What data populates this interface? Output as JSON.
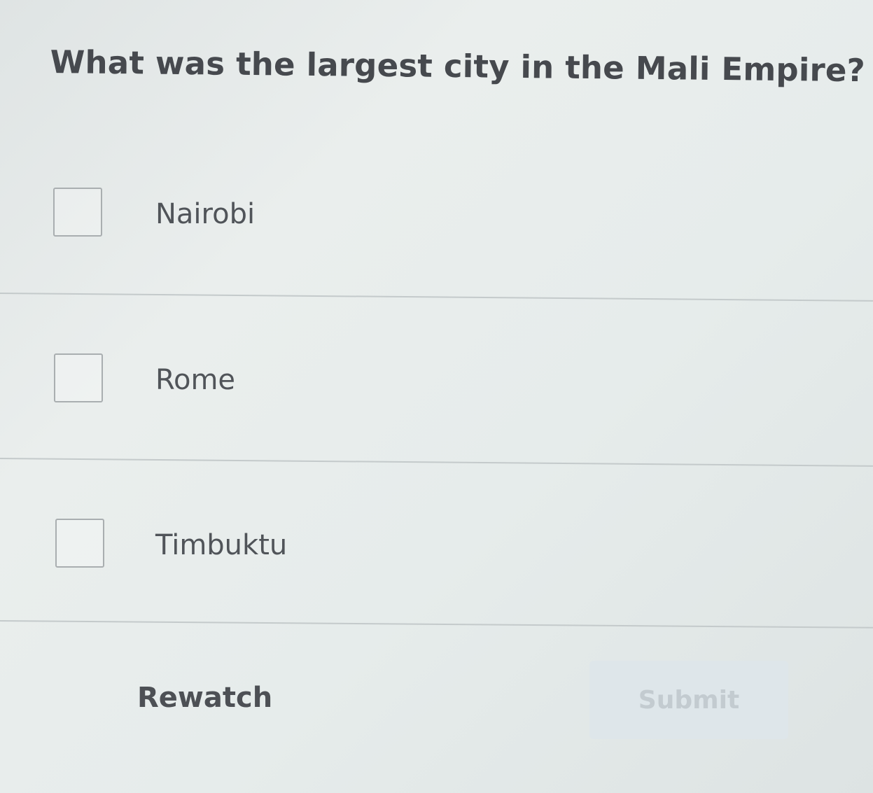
{
  "question": {
    "text": "What was the largest city in the Mali Empire?"
  },
  "options": [
    {
      "label": "Nairobi",
      "checked": false
    },
    {
      "label": "Rome",
      "checked": false
    },
    {
      "label": "Timbuktu",
      "checked": false
    }
  ],
  "actions": {
    "rewatch_label": "Rewatch",
    "submit_label": "Submit",
    "submit_enabled": false
  },
  "colors": {
    "background": "#e6eceb",
    "text": "#4a4d52",
    "submit_bg": "#dee6ea",
    "submit_text": "#c3cbd0",
    "divider": "#c4cacb"
  }
}
